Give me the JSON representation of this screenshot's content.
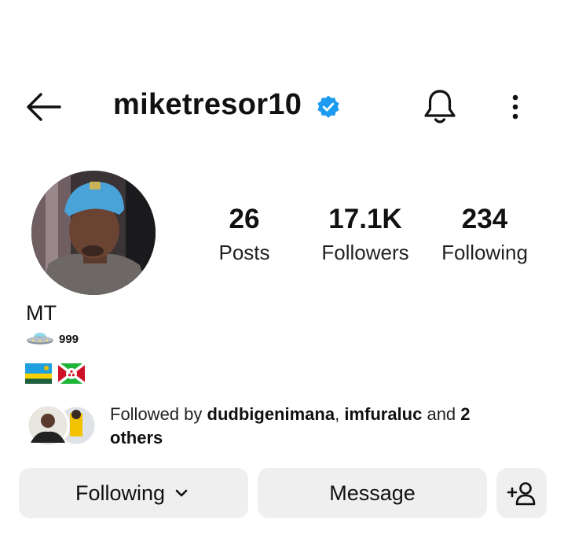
{
  "header": {
    "username": "miketresor10",
    "verified": true
  },
  "profile": {
    "display_name": "MT",
    "bio_line1_emoji": "ufo",
    "bio_line1_text": "999",
    "flags": [
      "rwanda-flag",
      "burundi-flag"
    ]
  },
  "stats": [
    {
      "value": "26",
      "label": "Posts"
    },
    {
      "value": "17.1K",
      "label": "Followers"
    },
    {
      "value": "234",
      "label": "Following"
    }
  ],
  "followed_by": {
    "prefix": "Followed by ",
    "user1": "dudbigenimana",
    "sep": ", ",
    "user2": "imfuraluc",
    "and": " and ",
    "count": "2",
    "others": "others"
  },
  "actions": {
    "following_label": "Following",
    "message_label": "Message"
  },
  "colors": {
    "verified_blue": "#1d9bf0",
    "button_bg": "#efefef"
  }
}
